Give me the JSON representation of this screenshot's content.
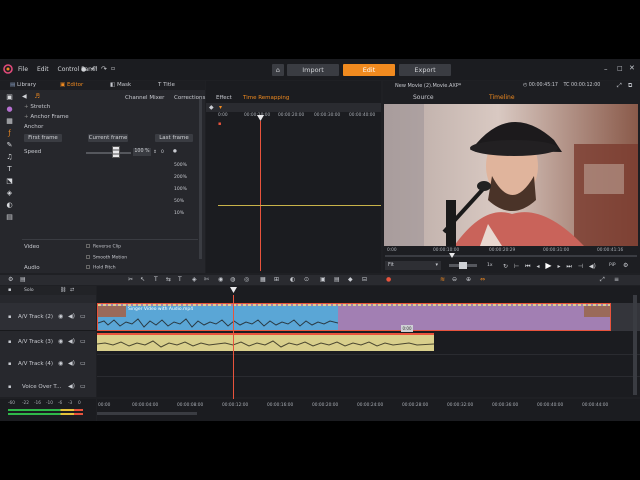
{
  "menu": {
    "items": [
      "File",
      "Edit",
      "Control Panel"
    ]
  },
  "modes": {
    "import": "Import",
    "edit": "Edit",
    "export": "Export"
  },
  "left_tabs": {
    "library": "Library",
    "editor": "Editor",
    "mask": "Mask",
    "title": "Title"
  },
  "editor_tabs": [
    "Channel Mixer",
    "Corrections",
    "Effect",
    "Time Remapping"
  ],
  "editor": {
    "stretch": "Stretch",
    "anchor_frame": "Anchor Frame",
    "anchor": "Anchor",
    "first_frame": "First frame",
    "current_frame": "Current frame",
    "last_frame": "Last frame",
    "speed": "Speed",
    "speed_value": "100 %",
    "speed_zero": "0",
    "speed_marks": [
      "500%",
      "200%",
      "100%",
      "50%",
      "10%"
    ],
    "video_label": "Video",
    "audio_label": "Audio",
    "reverse_clip": "Reverse Clip",
    "smooth_motion": "Smooth Motion",
    "hold_pitch": "Hold Pitch"
  },
  "keyframe_ruler": [
    "0:00",
    "00:00:10:00",
    "00:00:20:00",
    "00:00:30:00",
    "00:00:40:00"
  ],
  "preview": {
    "title": "New Movie (2).Movie.AXP*",
    "timecode_left": "00:00:45:17",
    "tc_label": "TC",
    "timecode_right": "00:00:12:00",
    "source_tab": "Source",
    "timeline_tab": "Timeline",
    "scrub_labels": [
      "0:00",
      "00:00:10:00",
      "00:00:20:29",
      "00:00:31:00",
      "00:00:41:16"
    ],
    "fit_label": "Fit",
    "speed_label": "1x",
    "pip_label": "PiP"
  },
  "timeline": {
    "solo_label": "Solo",
    "tracks": [
      {
        "name": "A/V Track (2)"
      },
      {
        "name": "A/V Track (3)"
      },
      {
        "name": "A/V Track (4)"
      },
      {
        "name": "Voice Over T..."
      }
    ],
    "clip_label": "Singer Video with Audio.mp4",
    "small_tag": "0:00",
    "ruler": [
      "00:00",
      "00:00:04:00",
      "00:00:08:00",
      "00:00:12:00",
      "00:00:16:00",
      "00:00:20:00",
      "00:00:24:00",
      "00:00:28:00",
      "00:00:32:00",
      "00:00:36:00",
      "00:00:40:00",
      "00:00:44:00"
    ],
    "meter_labels": [
      "-60",
      "-22",
      "-16",
      "-10",
      "-6",
      "-3",
      "0"
    ]
  },
  "colors": {
    "accent": "#f08a1f",
    "clip_video": "#5aa6d6",
    "clip_purple": "#a27fb3",
    "clip_audio": "#d9cf8c",
    "playhead": "#e8533c"
  }
}
